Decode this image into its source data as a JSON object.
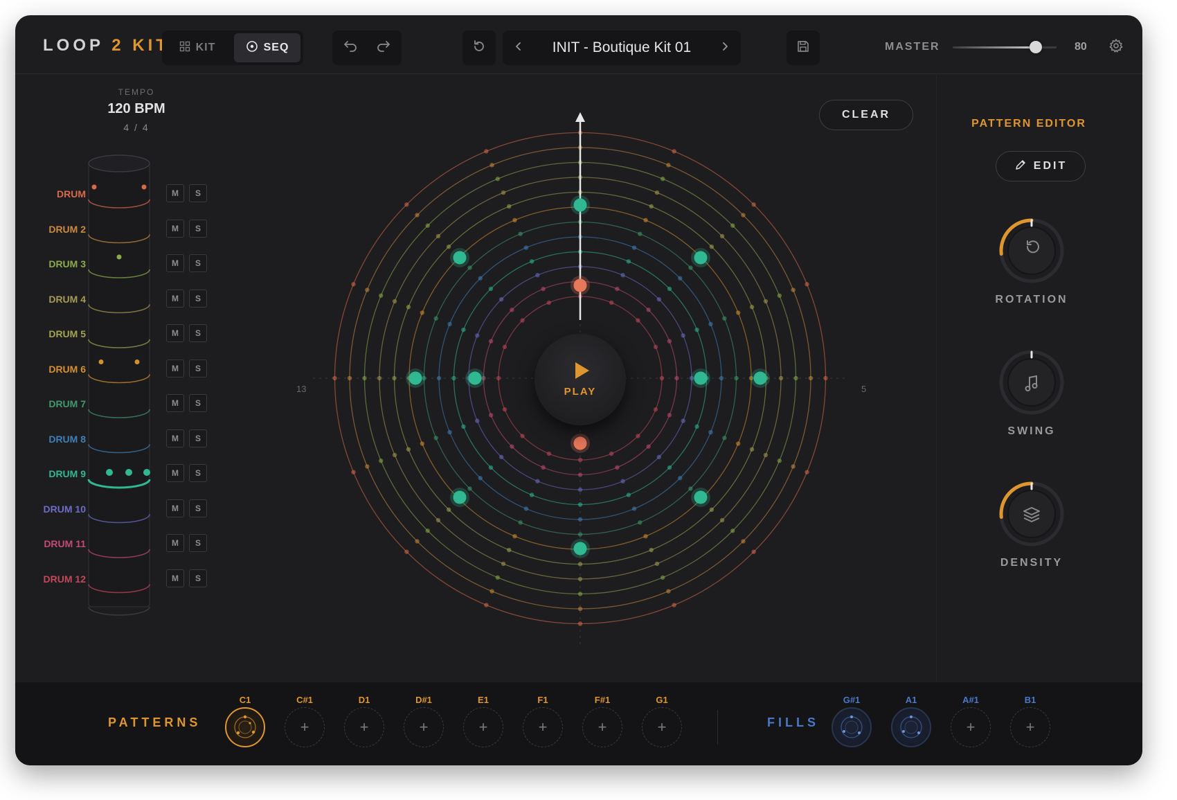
{
  "header": {
    "logo": {
      "part1": "LOOP",
      "part2": "2",
      "part3": "KIT"
    },
    "mode_tabs": [
      {
        "label": "KIT",
        "icon": "grid-icon",
        "active": false
      },
      {
        "label": "SEQ",
        "icon": "target-icon",
        "active": true
      }
    ],
    "preset_name": "INIT - Boutique Kit 01",
    "master_label": "MASTER",
    "master_value": "80",
    "master_level": 0.8
  },
  "tempo": {
    "label": "TEMPO",
    "value": "120 BPM",
    "time_signature": "4 / 4"
  },
  "tracks": [
    {
      "name": "DRUM",
      "color": "#d96a48",
      "mute": "M",
      "solo": "S"
    },
    {
      "name": "DRUM 2",
      "color": "#c98a3e",
      "mute": "M",
      "solo": "S"
    },
    {
      "name": "DRUM 3",
      "color": "#8bab4a",
      "mute": "M",
      "solo": "S"
    },
    {
      "name": "DRUM 4",
      "color": "#a89a52",
      "mute": "M",
      "solo": "S"
    },
    {
      "name": "DRUM 5",
      "color": "#a3a54e",
      "mute": "M",
      "solo": "S"
    },
    {
      "name": "DRUM 6",
      "color": "#d6902e",
      "mute": "M",
      "solo": "S"
    },
    {
      "name": "DRUM 7",
      "color": "#3e9a6c",
      "mute": "M",
      "solo": "S"
    },
    {
      "name": "DRUM 8",
      "color": "#3f7fb8",
      "mute": "M",
      "solo": "S"
    },
    {
      "name": "DRUM 9",
      "color": "#2fb891",
      "mute": "M",
      "solo": "S"
    },
    {
      "name": "DRUM 10",
      "color": "#6e6cc6",
      "mute": "M",
      "solo": "S"
    },
    {
      "name": "DRUM 11",
      "color": "#c24a74",
      "mute": "M",
      "solo": "S"
    },
    {
      "name": "DRUM 12",
      "color": "#c2485a",
      "mute": "M",
      "solo": "S"
    }
  ],
  "sequencer": {
    "clear_label": "CLEAR",
    "play_label": "PLAY",
    "left_number": "13",
    "right_number": "5"
  },
  "pattern_editor": {
    "title": "PATTERN EDITOR",
    "edit_label": "EDIT",
    "knobs": [
      {
        "label": "ROTATION",
        "icon": "rotate-icon",
        "value": 0.4
      },
      {
        "label": "SWING",
        "icon": "music-note-icon",
        "value": 0.0
      },
      {
        "label": "DENSITY",
        "icon": "layers-icon",
        "value": 0.4
      }
    ]
  },
  "patterns": {
    "label": "PATTERNS",
    "slots": [
      {
        "note": "C1",
        "active": true
      },
      {
        "note": "C#1",
        "active": false
      },
      {
        "note": "D1",
        "active": false
      },
      {
        "note": "D#1",
        "active": false
      },
      {
        "note": "E1",
        "active": false
      },
      {
        "note": "F1",
        "active": false
      },
      {
        "note": "F#1",
        "active": false
      },
      {
        "note": "G1",
        "active": false
      }
    ]
  },
  "fills": {
    "label": "FILLS",
    "slots": [
      {
        "note": "G#1",
        "used": true
      },
      {
        "note": "A1",
        "used": true
      },
      {
        "note": "A#1",
        "used": false
      },
      {
        "note": "B1",
        "used": false
      }
    ]
  },
  "colors": {
    "accent": "#e0962e",
    "fills": "#4a78c8",
    "active_step": "#2fb891",
    "playhead_step": "#e8785a"
  }
}
